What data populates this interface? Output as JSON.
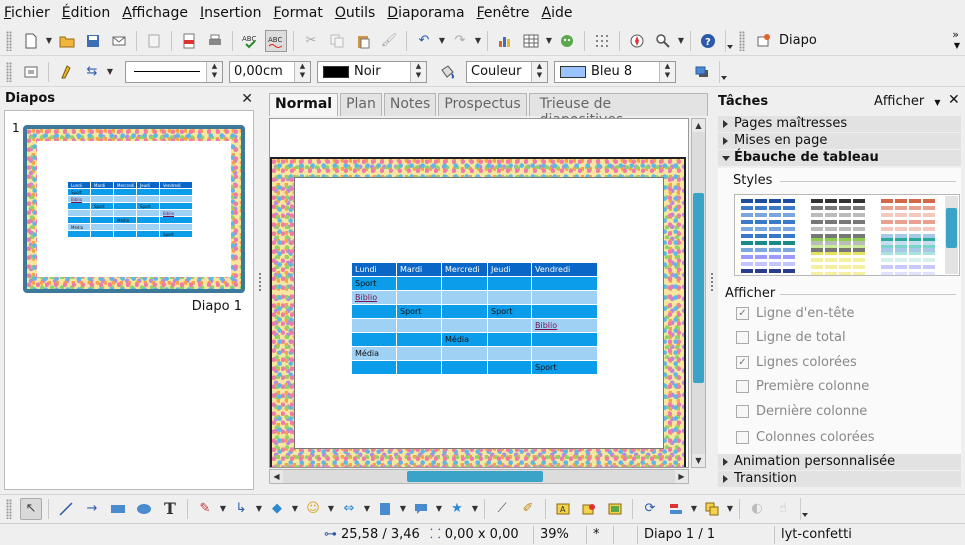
{
  "menu": [
    {
      "label": "Fichier",
      "u": "F",
      "rest": "ichier"
    },
    {
      "label": "Édition",
      "u": "É",
      "rest": "dition"
    },
    {
      "label": "Affichage",
      "u": "A",
      "rest": "ffichage"
    },
    {
      "label": "Insertion",
      "u": "I",
      "rest": "nsertion"
    },
    {
      "label": "Format",
      "u": "F",
      "rest": "ormat"
    },
    {
      "label": "Outils",
      "u": "O",
      "rest": "utils"
    },
    {
      "label": "Diaporama",
      "u": "D",
      "rest": "iaporama"
    },
    {
      "label": "Fenêtre",
      "u": "F",
      "rest": "enêtre"
    },
    {
      "label": "Aide",
      "u": "A",
      "rest": "ide"
    }
  ],
  "toolbar1": {
    "slide_button": "Diapo"
  },
  "toolbar2": {
    "line_width": "0,00cm",
    "line_color": "Noir",
    "line_color_hex": "#000000",
    "fill_type": "Couleur",
    "fill_color": "Bleu 8",
    "fill_color_hex": "#99c4ff"
  },
  "slides_panel": {
    "title": "Diapos",
    "slide_number": "1",
    "slide_label": "Diapo 1"
  },
  "tabs": [
    "Normal",
    "Plan",
    "Notes",
    "Prospectus",
    "Trieuse de diapositives"
  ],
  "table": {
    "headers": [
      "Lundi",
      "Mardi",
      "Mercredi",
      "Jeudi",
      "Vendredi"
    ],
    "rows": [
      [
        "Sport",
        "",
        "",
        "",
        ""
      ],
      [
        "Biblio",
        "",
        "",
        "",
        ""
      ],
      [
        "",
        "Sport",
        "",
        "Sport",
        ""
      ],
      [
        "",
        "",
        "",
        "",
        "Biblio"
      ],
      [
        "",
        "",
        "Média",
        "",
        ""
      ],
      [
        "Média",
        "",
        "",
        "",
        ""
      ],
      [
        "",
        "",
        "",
        "",
        "Sport"
      ]
    ]
  },
  "tasks": {
    "title": "Tâches",
    "view_label": "Afficher",
    "sections": {
      "master_pages": "Pages maîtresses",
      "layouts": "Mises en page",
      "table_design": "Ébauche de tableau",
      "custom_animation": "Animation personnalisée",
      "transition": "Transition"
    },
    "styles_label": "Styles",
    "show_label": "Afficher",
    "options": [
      {
        "label": "Ligne d'en-tête",
        "checked": true
      },
      {
        "label": "Ligne de total",
        "checked": false
      },
      {
        "label": "Lignes colorées",
        "checked": true
      },
      {
        "label": "Première colonne",
        "checked": false
      },
      {
        "label": "Dernière colonne",
        "checked": false
      },
      {
        "label": "Colonnes colorées",
        "checked": false
      }
    ]
  },
  "status": {
    "position": "25,58 / 3,46",
    "size": "0,00 x 0,00",
    "zoom": "39%",
    "modified": "*",
    "slide": "Diapo 1 / 1",
    "master": "lyt-confetti"
  },
  "colors": {
    "table_header": "#0a67c7",
    "table_dark": "#0b9cea",
    "table_light": "#9fd1f5",
    "accent": "#3aa3c7"
  }
}
